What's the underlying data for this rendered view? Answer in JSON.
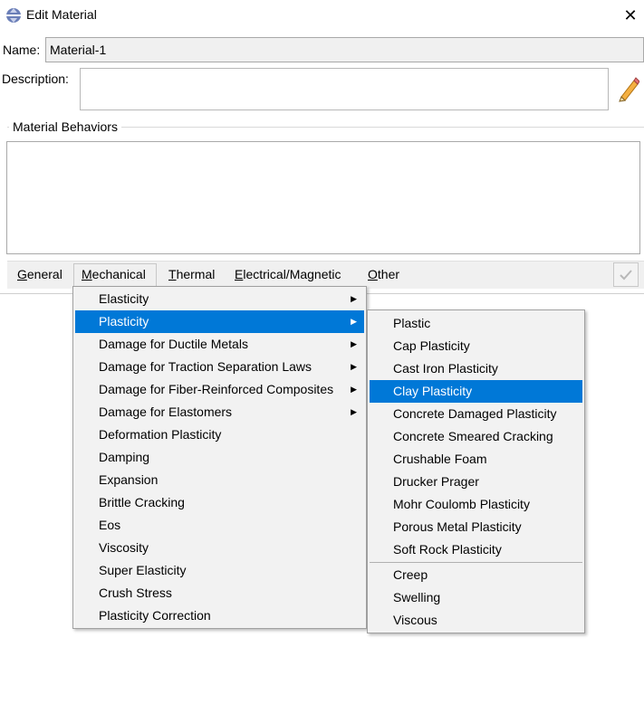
{
  "window": {
    "title": "Edit Material",
    "close_glyph": "✕"
  },
  "form": {
    "name_label": "Name:",
    "name_value": "Material-1",
    "description_label": "Description:",
    "description_value": ""
  },
  "group": {
    "title": "Material Behaviors"
  },
  "menubar": {
    "items": [
      {
        "label": "General",
        "mnemonic": "G",
        "rest": "eneral"
      },
      {
        "label": "Mechanical",
        "mnemonic": "M",
        "rest": "echanical"
      },
      {
        "label": "Thermal",
        "mnemonic": "T",
        "rest": "hermal"
      },
      {
        "label": "Electrical/Magnetic",
        "mnemonic": "E",
        "rest": "lectrical/Magnetic"
      },
      {
        "label": "Other",
        "mnemonic": "O",
        "rest": "ther"
      }
    ]
  },
  "mechanical_menu": {
    "items": [
      {
        "label": "Elasticity",
        "has_submenu": true
      },
      {
        "label": "Plasticity",
        "has_submenu": true,
        "selected": true
      },
      {
        "label": "Damage for Ductile Metals",
        "has_submenu": true
      },
      {
        "label": "Damage for Traction Separation Laws",
        "has_submenu": true
      },
      {
        "label": "Damage for Fiber-Reinforced Composites",
        "has_submenu": true
      },
      {
        "label": "Damage for Elastomers",
        "has_submenu": true
      },
      {
        "label": "Deformation Plasticity",
        "has_submenu": false
      },
      {
        "label": "Damping",
        "has_submenu": false
      },
      {
        "label": "Expansion",
        "has_submenu": false
      },
      {
        "label": "Brittle Cracking",
        "has_submenu": false
      },
      {
        "label": "Eos",
        "has_submenu": false
      },
      {
        "label": "Viscosity",
        "has_submenu": false
      },
      {
        "label": "Super Elasticity",
        "has_submenu": false
      },
      {
        "label": "Crush Stress",
        "has_submenu": false
      },
      {
        "label": "Plasticity Correction",
        "has_submenu": false
      }
    ]
  },
  "plasticity_menu": {
    "items": [
      {
        "label": "Plastic"
      },
      {
        "label": "Cap Plasticity"
      },
      {
        "label": "Cast Iron Plasticity"
      },
      {
        "label": "Clay Plasticity",
        "selected": true
      },
      {
        "label": "Concrete Damaged Plasticity"
      },
      {
        "label": "Concrete Smeared Cracking"
      },
      {
        "label": "Crushable Foam"
      },
      {
        "label": "Drucker Prager"
      },
      {
        "label": "Mohr Coulomb Plasticity"
      },
      {
        "label": "Porous Metal Plasticity"
      },
      {
        "label": "Soft Rock Plasticity"
      },
      {
        "label": "Creep"
      },
      {
        "label": "Swelling"
      },
      {
        "label": "Viscous"
      }
    ]
  },
  "icons": {
    "app": "abaqus-app-icon",
    "pencil": "pencil-edit-icon",
    "tool": "checkmark-tool-icon"
  },
  "colors": {
    "selection": "#0078d7",
    "menu_background": "#f2f2f2"
  }
}
